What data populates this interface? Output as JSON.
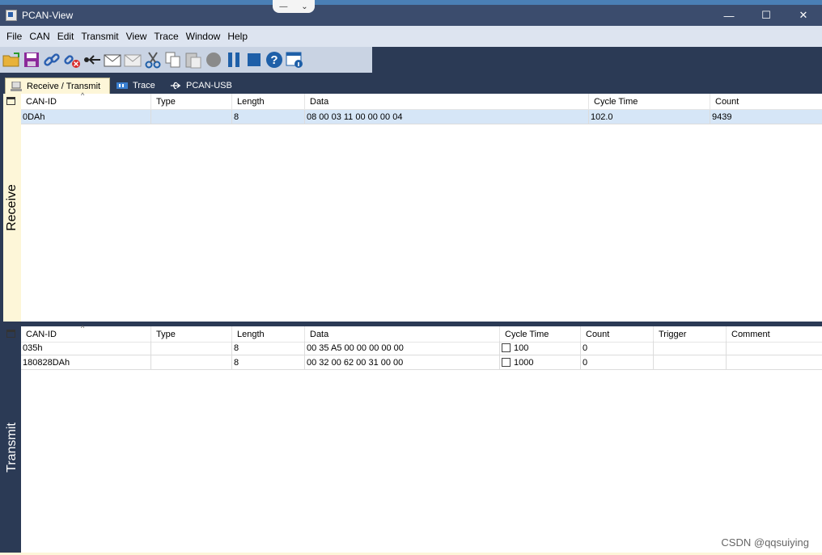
{
  "window": {
    "title": "PCAN-View",
    "minimize": "—",
    "maximize": "☐",
    "close": "✕"
  },
  "menu": [
    "File",
    "CAN",
    "Edit",
    "Transmit",
    "View",
    "Trace",
    "Window",
    "Help"
  ],
  "toolbar_icons": [
    "open-folder-icon",
    "save-icon",
    "connect-icon",
    "disconnect-icon",
    "reset-icon",
    "send-message-icon",
    "send-disabled-icon",
    "cut-icon",
    "copy-icon",
    "paste-icon",
    "record-icon",
    "pause-icon",
    "stop-icon",
    "help-icon",
    "about-icon"
  ],
  "tabs": [
    {
      "label": "Receive / Transmit",
      "active": true
    },
    {
      "label": "Trace",
      "active": false
    },
    {
      "label": "PCAN-USB",
      "active": false
    }
  ],
  "receive": {
    "side_label": "Receive",
    "columns": [
      "CAN-ID",
      "Type",
      "Length",
      "Data",
      "Cycle Time",
      "Count"
    ],
    "rows": [
      {
        "can_id": "0DAh",
        "type": "",
        "length": "8",
        "data": "08 00 03 11 00 00 00 04",
        "cycle_time": "102.0",
        "count": "9439"
      }
    ]
  },
  "transmit": {
    "side_label": "Transmit",
    "columns": [
      "CAN-ID",
      "Type",
      "Length",
      "Data",
      "Cycle Time",
      "Count",
      "Trigger",
      "Comment"
    ],
    "rows": [
      {
        "can_id": "035h",
        "type": "",
        "length": "8",
        "data": "00 35 A5 00 00 00 00 00",
        "cycle_time": "100",
        "count": "0",
        "trigger": "",
        "comment": ""
      },
      {
        "can_id": "180828DAh",
        "type": "",
        "length": "8",
        "data": "00 32 00 62 00 31 00 00",
        "cycle_time": "1000",
        "count": "0",
        "trigger": "",
        "comment": ""
      }
    ]
  },
  "watermark": "CSDN @qqsuiying",
  "colors": {
    "accent_dark": "#2b3a55",
    "selection": "#d6e6f7",
    "tab_active": "#fdf6d8"
  }
}
